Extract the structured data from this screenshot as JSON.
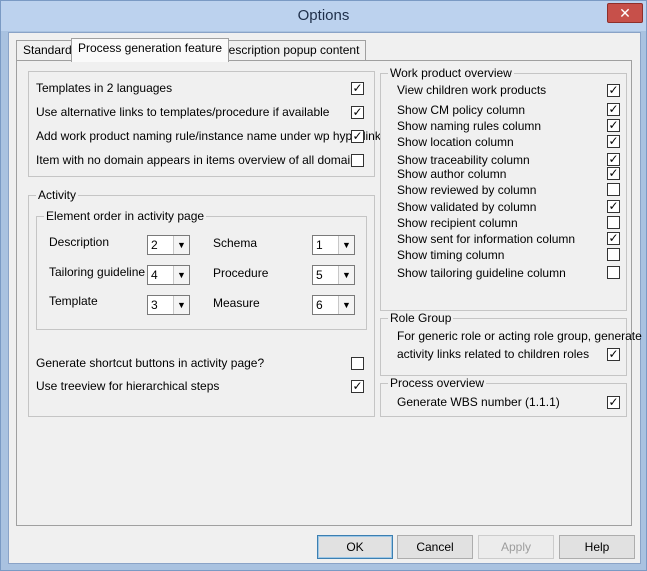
{
  "window": {
    "title": "Options",
    "close_glyph": "✕"
  },
  "tabs": [
    {
      "label": "Standard",
      "active": false
    },
    {
      "label": "Process generation feature",
      "active": true
    },
    {
      "label": "Description popup content",
      "active": false
    }
  ],
  "general": {
    "items": [
      {
        "label": "Templates in 2 languages",
        "checked": true
      },
      {
        "label": "Use alternative links to templates/procedure if available",
        "checked": true
      },
      {
        "label": "Add work product naming rule/instance name under wp hyperlink",
        "checked": true
      },
      {
        "label": "Item with no domain appears in items overview of all domains",
        "checked": false
      }
    ]
  },
  "activity": {
    "legend": "Activity",
    "element_order": {
      "legend": "Element order in activity page",
      "fields": [
        {
          "label": "Description",
          "value": "2"
        },
        {
          "label": "Schema",
          "value": "1"
        },
        {
          "label": "Tailoring guideline",
          "value": "4"
        },
        {
          "label": "Procedure",
          "value": "5"
        },
        {
          "label": "Template",
          "value": "3"
        },
        {
          "label": "Measure",
          "value": "6"
        }
      ]
    },
    "options": [
      {
        "label": "Generate shortcut buttons in activity page?",
        "checked": false
      },
      {
        "label": "Use treeview for hierarchical steps",
        "checked": true
      }
    ]
  },
  "work_product_overview": {
    "legend": "Work product overview",
    "items": [
      {
        "label": "View children work products",
        "checked": true
      },
      {
        "label": "Show CM policy column",
        "checked": true
      },
      {
        "label": "Show naming rules column",
        "checked": true
      },
      {
        "label": "Show location column",
        "checked": true
      },
      {
        "label": "Show traceability column",
        "checked": true
      },
      {
        "label": "Show author column",
        "checked": true
      },
      {
        "label": "Show reviewed by column",
        "checked": false
      },
      {
        "label": "Show validated by column",
        "checked": true
      },
      {
        "label": "Show recipient column",
        "checked": false
      },
      {
        "label": "Show sent for information column",
        "checked": true
      },
      {
        "label": "Show timing column",
        "checked": false
      },
      {
        "label": "Show tailoring guideline column",
        "checked": false
      }
    ]
  },
  "role_group": {
    "legend": "Role Group",
    "line1": "For generic role or acting role  group, generate",
    "line2": "activity links related to children roles",
    "checked": true
  },
  "process_overview": {
    "legend": "Process overview",
    "item": {
      "label": "Generate WBS number (1.1.1)",
      "checked": true
    }
  },
  "buttons": {
    "ok": "OK",
    "cancel": "Cancel",
    "apply": "Apply",
    "help": "Help"
  },
  "check_glyph": "✓",
  "arrow_glyph": "▼"
}
